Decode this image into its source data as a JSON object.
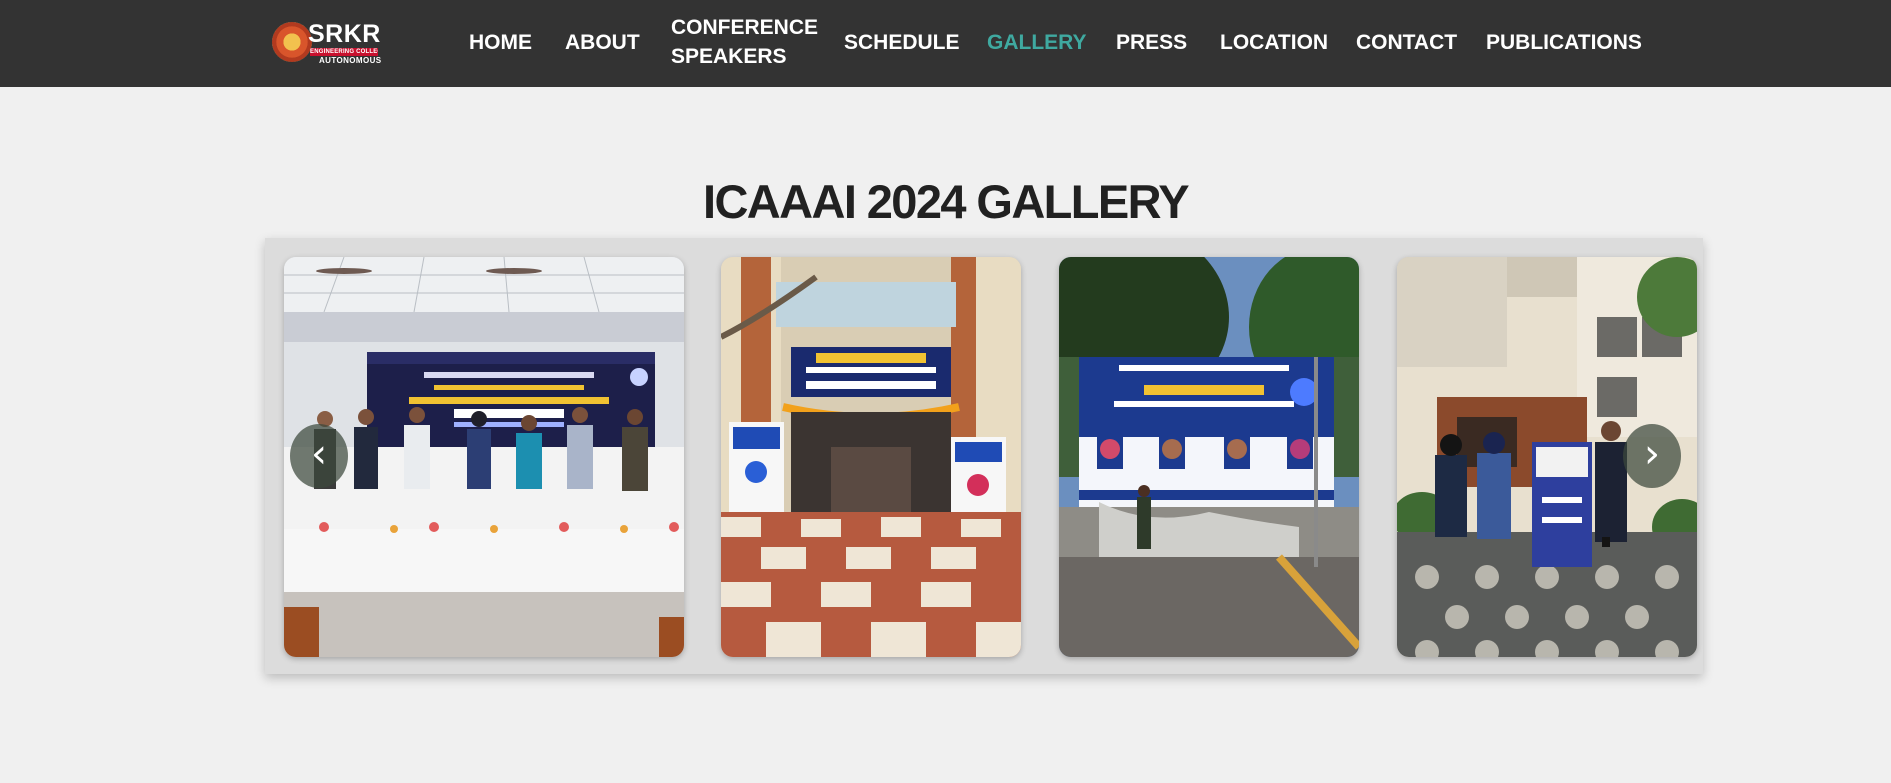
{
  "logo": {
    "wordmark": "SRKR",
    "bar_text": "ENGINEERING COLLEGE",
    "subtitle": "AUTONOMOUS"
  },
  "nav": {
    "items": [
      {
        "label": "HOME",
        "active": false
      },
      {
        "label": "ABOUT",
        "active": false
      },
      {
        "label_line1": "CONFERENCE",
        "label_line2": "SPEAKERS",
        "active": false
      },
      {
        "label": "SCHEDULE",
        "active": false
      },
      {
        "label": "GALLERY",
        "active": true
      },
      {
        "label": "PRESS",
        "active": false
      },
      {
        "label": "LOCATION",
        "active": false
      },
      {
        "label": "CONTACT",
        "active": false
      },
      {
        "label": "PUBLICATIONS",
        "active": false
      }
    ]
  },
  "page": {
    "title": "ICAAAI 2024 GALLERY"
  },
  "gallery": {
    "prev_icon": "‹",
    "next_icon": "›",
    "photos": [
      {
        "subject": "inauguration-stage-photo"
      },
      {
        "subject": "venue-entrance-photo"
      },
      {
        "subject": "welcome-banner-photo"
      },
      {
        "subject": "delegates-standee-photo"
      }
    ]
  },
  "colors": {
    "navbar_bg": "#333333",
    "nav_text": "#ffffff",
    "nav_active": "#3fa9a0",
    "page_bg": "#f0f0f0",
    "title": "#212121"
  }
}
